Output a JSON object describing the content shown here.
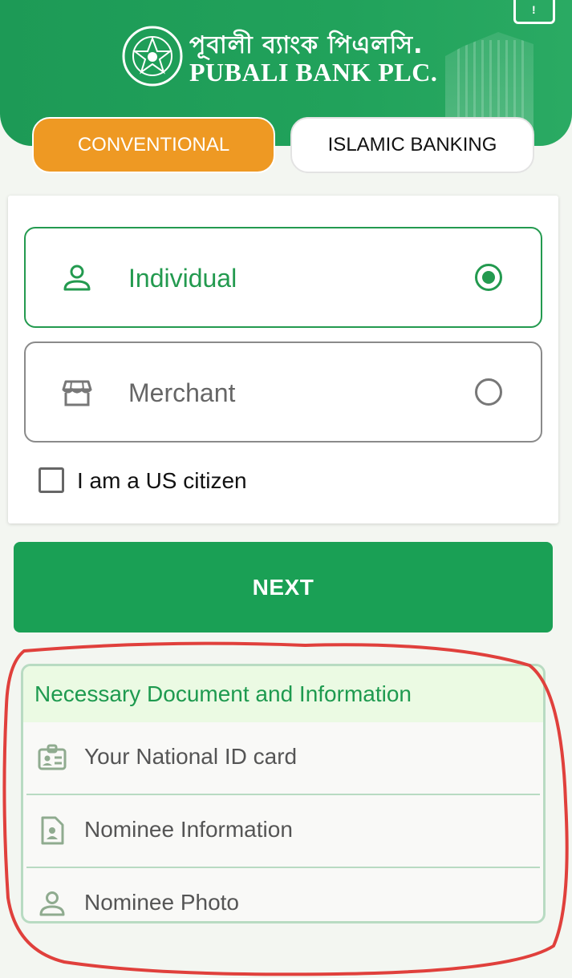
{
  "header": {
    "logo_bn": "পূবালী ব্যাংক পিএলসি.",
    "logo_en": "PUBALI BANK PLC.",
    "corner_icon": "info-book-icon",
    "brand_color": "#1d9a56"
  },
  "tabs": [
    {
      "label": "CONVENTIONAL",
      "active": true,
      "color": "#ee9923"
    },
    {
      "label": "ISLAMIC BANKING",
      "active": false
    }
  ],
  "account_types": [
    {
      "label": "Individual",
      "icon": "person-icon",
      "selected": true
    },
    {
      "label": "Merchant",
      "icon": "store-icon",
      "selected": false
    }
  ],
  "us_citizen": {
    "label": "I am a US citizen",
    "checked": false
  },
  "next_button": {
    "label": "NEXT"
  },
  "documents": {
    "title": "Necessary Document and Information",
    "items": [
      {
        "label": "Your National ID card",
        "icon": "id-card-icon"
      },
      {
        "label": "Nominee Information",
        "icon": "document-person-icon"
      },
      {
        "label": "Nominee Photo",
        "icon": "person-icon"
      }
    ]
  },
  "annotation_color": "#e0403c"
}
